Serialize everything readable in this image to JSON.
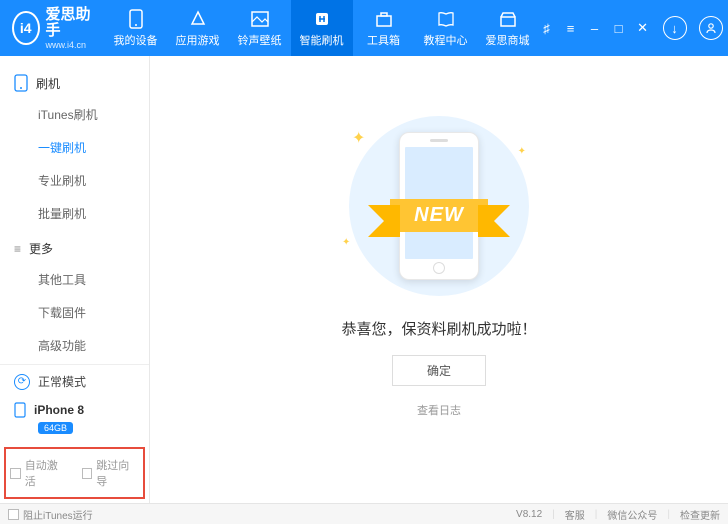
{
  "app": {
    "name": "爱思助手",
    "url": "www.i4.cn",
    "logo_text": "i4"
  },
  "tabs": [
    {
      "label": "我的设备"
    },
    {
      "label": "应用游戏"
    },
    {
      "label": "铃声壁纸"
    },
    {
      "label": "智能刷机",
      "active": true
    },
    {
      "label": "工具箱"
    },
    {
      "label": "教程中心"
    },
    {
      "label": "爱思商城"
    }
  ],
  "sidebar": {
    "group1": {
      "title": "刷机",
      "items": [
        "iTunes刷机",
        "一键刷机",
        "专业刷机",
        "批量刷机"
      ],
      "active_index": 1
    },
    "group2": {
      "title": "更多",
      "items": [
        "其他工具",
        "下载固件",
        "高级功能"
      ]
    },
    "mode": "正常模式",
    "device": {
      "name": "iPhone 8",
      "storage": "64GB"
    },
    "checks": {
      "auto_activate": "自动激活",
      "skip_guide": "跳过向导"
    }
  },
  "main": {
    "ribbon": "NEW",
    "message": "恭喜您，保资料刷机成功啦！",
    "ok": "确定",
    "log": "查看日志"
  },
  "footer": {
    "block_itunes": "阻止iTunes运行",
    "version": "V8.12",
    "support": "客服",
    "wechat": "微信公众号",
    "update": "检查更新"
  }
}
